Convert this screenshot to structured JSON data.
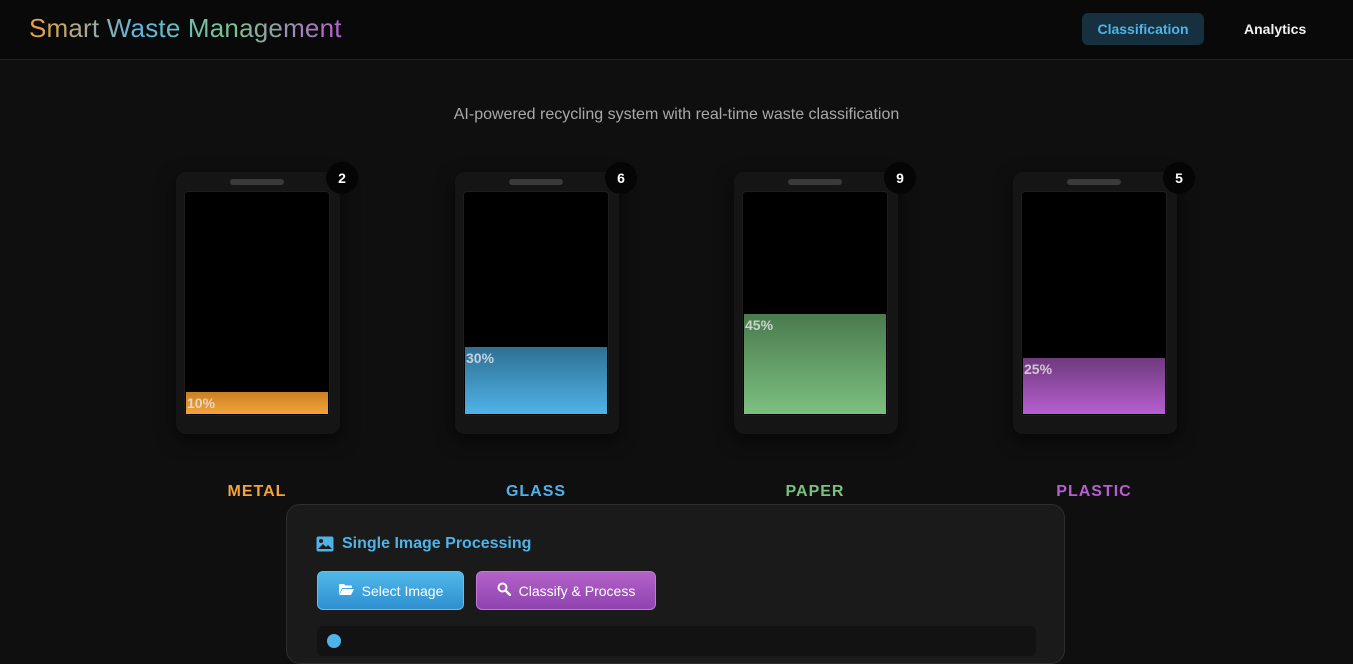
{
  "header": {
    "brand": "Smart Waste Management",
    "nav": [
      {
        "label": "Classification",
        "active": true
      },
      {
        "label": "Analytics",
        "active": false
      }
    ]
  },
  "subtitle": "AI-powered recycling system with real-time waste classification",
  "bins": [
    {
      "label": "METAL",
      "count": "2",
      "fill_percent": 10,
      "fill_label": "10%",
      "color": "#f5a33a",
      "color_dark": "#c98022"
    },
    {
      "label": "GLASS",
      "count": "6",
      "fill_percent": 30,
      "fill_label": "30%",
      "color": "#4fb3e8",
      "color_dark": "#2f6f93"
    },
    {
      "label": "PAPER",
      "count": "9",
      "fill_percent": 45,
      "fill_label": "45%",
      "color": "#7cc07f",
      "color_dark": "#4a7a4e"
    },
    {
      "label": "PLASTIC",
      "count": "5",
      "fill_percent": 25,
      "fill_label": "25%",
      "color": "#b75fd0",
      "color_dark": "#6e3a7d"
    }
  ],
  "panel": {
    "title": "Single Image Processing",
    "title_icon": "image-icon",
    "select_button": "Select Image",
    "select_icon": "folder-open-icon",
    "classify_button": "Classify & Process",
    "classify_icon": "search-icon"
  }
}
